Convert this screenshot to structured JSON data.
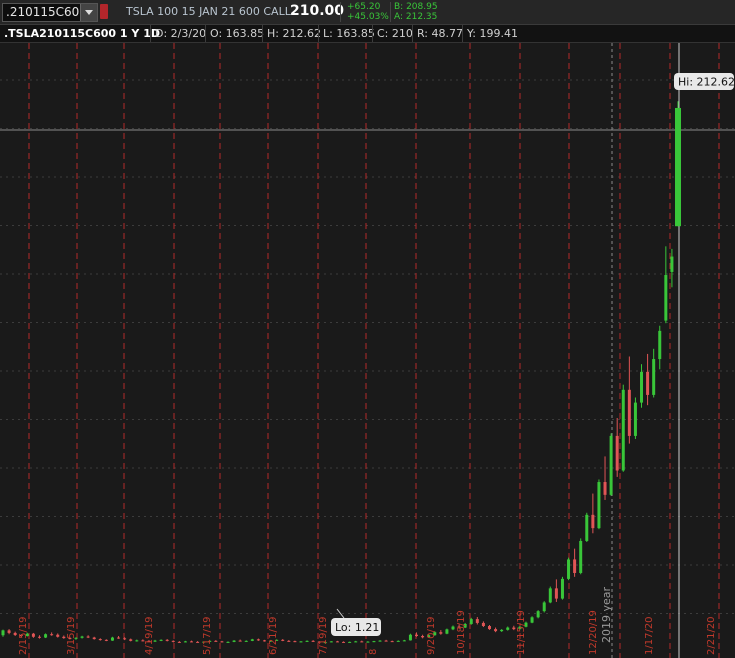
{
  "header": {
    "symbol": ".210115C600",
    "description": "TSLA 100 15 JAN 21 600 CALL",
    "last": "210.00",
    "net_change": "+65.20",
    "pct_change": "+45.03%",
    "bid": "B: 208.95",
    "ask": "A: 212.35"
  },
  "infobar": {
    "title": ".TSLA210115C600 1 Y 1D",
    "date": "D: 2/3/20",
    "open": "O: 163.85",
    "high": "H: 212.62",
    "low": "L: 163.85",
    "close": "C: 210",
    "range": "R: 48.77",
    "y": "Y: 199.41"
  },
  "chart_data": {
    "type": "candlestick",
    "x_tick_labels": [
      "2/15/19",
      "3/15/19",
      "4/19/19",
      "5/17/19",
      "6/21/19",
      "7/19/19",
      "8",
      "9/20/19",
      "10/18/19",
      "11/15/19",
      "12/20/19",
      "1/17/20",
      "2/21/20"
    ],
    "year_label": "2019 year",
    "high_label": "Hi: 212.62",
    "low_label": "Lo: 1.21",
    "ylim": [
      0,
      233
    ],
    "grid": true,
    "colors": {
      "up": "#39c639",
      "down": "#e05555",
      "grid": "#b32b2b",
      "background": "#1a1a1a"
    },
    "candles": [
      [
        4.2,
        6.4,
        3.6,
        6.1
      ],
      [
        6.1,
        6.6,
        4.6,
        5.1
      ],
      [
        5.1,
        5.6,
        3.9,
        4.3
      ],
      [
        4.3,
        4.6,
        3.4,
        3.9
      ],
      [
        3.9,
        5.2,
        3.7,
        4.8
      ],
      [
        4.8,
        5.1,
        3.2,
        3.6
      ],
      [
        3.6,
        4.2,
        2.9,
        3.3
      ],
      [
        3.3,
        4.9,
        3.1,
        4.6
      ],
      [
        4.6,
        5.3,
        4.0,
        4.4
      ],
      [
        4.4,
        4.9,
        3.3,
        3.6
      ],
      [
        3.6,
        4.1,
        2.8,
        3.1
      ],
      [
        3.1,
        3.6,
        2.6,
        2.9
      ],
      [
        2.9,
        3.4,
        2.4,
        3.2
      ],
      [
        3.2,
        4.0,
        2.9,
        3.7
      ],
      [
        3.7,
        4.2,
        3.1,
        3.3
      ],
      [
        3.3,
        3.6,
        2.5,
        2.7
      ],
      [
        2.7,
        3.0,
        2.1,
        2.4
      ],
      [
        2.4,
        2.6,
        1.9,
        2.1
      ],
      [
        2.1,
        3.6,
        2.0,
        3.3
      ],
      [
        3.3,
        3.9,
        2.8,
        3.0
      ],
      [
        3.0,
        3.4,
        2.3,
        2.6
      ],
      [
        2.6,
        2.9,
        1.8,
        2.0
      ],
      [
        2.0,
        2.5,
        1.7,
        2.2
      ],
      [
        2.2,
        2.6,
        1.8,
        2.0
      ],
      [
        2.0,
        2.3,
        1.5,
        1.7
      ],
      [
        1.7,
        2.4,
        1.6,
        2.1
      ],
      [
        2.1,
        2.6,
        1.9,
        2.4
      ],
      [
        2.4,
        2.7,
        1.8,
        2.0
      ],
      [
        2.0,
        2.2,
        1.4,
        1.6
      ],
      [
        1.6,
        1.9,
        1.3,
        1.5
      ],
      [
        1.5,
        2.0,
        1.4,
        1.8
      ],
      [
        1.8,
        2.1,
        1.5,
        1.6
      ],
      [
        1.6,
        1.9,
        1.3,
        1.4
      ],
      [
        1.4,
        1.8,
        1.3,
        1.7
      ],
      [
        1.7,
        2.2,
        1.6,
        2.0
      ],
      [
        2.0,
        2.3,
        1.7,
        1.8
      ],
      [
        1.8,
        2.0,
        1.4,
        1.5
      ],
      [
        1.5,
        1.8,
        1.3,
        1.6
      ],
      [
        1.6,
        2.3,
        1.5,
        2.1
      ],
      [
        2.1,
        2.5,
        1.8,
        1.9
      ],
      [
        1.9,
        2.2,
        1.6,
        2.0
      ],
      [
        2.0,
        2.8,
        1.9,
        2.6
      ],
      [
        2.6,
        2.9,
        2.0,
        2.2
      ],
      [
        2.2,
        2.4,
        1.7,
        1.9
      ],
      [
        1.9,
        2.2,
        1.6,
        2.1
      ],
      [
        2.1,
        2.6,
        2.0,
        2.4
      ],
      [
        2.4,
        2.7,
        1.9,
        2.0
      ],
      [
        2.0,
        2.3,
        1.7,
        1.9
      ],
      [
        1.9,
        2.1,
        1.5,
        1.6
      ],
      [
        1.6,
        1.9,
        1.4,
        1.8
      ],
      [
        1.8,
        2.2,
        1.6,
        2.0
      ],
      [
        2.0,
        2.3,
        1.6,
        1.7
      ],
      [
        1.7,
        1.9,
        1.3,
        1.4
      ],
      [
        1.4,
        1.7,
        1.21,
        1.5
      ],
      [
        1.5,
        1.9,
        1.4,
        1.8
      ],
      [
        1.8,
        2.0,
        1.5,
        1.6
      ],
      [
        1.6,
        1.8,
        1.3,
        1.4
      ],
      [
        1.4,
        1.7,
        1.3,
        1.6
      ],
      [
        1.6,
        2.0,
        1.5,
        1.8
      ],
      [
        1.8,
        2.1,
        1.5,
        1.6
      ],
      [
        1.6,
        1.9,
        1.4,
        1.7
      ],
      [
        1.7,
        2.0,
        1.5,
        1.9
      ],
      [
        1.9,
        2.3,
        1.7,
        2.1
      ],
      [
        2.1,
        2.4,
        1.8,
        1.9
      ],
      [
        1.9,
        2.1,
        1.6,
        1.8
      ],
      [
        1.8,
        2.2,
        1.7,
        2.0
      ],
      [
        2.0,
        2.4,
        1.9,
        2.2
      ],
      [
        2.2,
        4.8,
        2.1,
        4.4
      ],
      [
        4.4,
        5.3,
        3.6,
        3.9
      ],
      [
        3.9,
        4.4,
        3.0,
        3.4
      ],
      [
        3.4,
        4.6,
        3.2,
        4.2
      ],
      [
        4.2,
        5.8,
        4.0,
        5.4
      ],
      [
        5.4,
        6.2,
        4.4,
        4.8
      ],
      [
        4.8,
        6.8,
        4.6,
        6.5
      ],
      [
        6.5,
        8.0,
        6.2,
        7.6
      ],
      [
        7.6,
        8.4,
        6.8,
        7.2
      ],
      [
        7.2,
        9.0,
        7.0,
        8.6
      ],
      [
        8.6,
        11.0,
        8.3,
        10.5
      ],
      [
        10.5,
        11.3,
        8.4,
        9.0
      ],
      [
        9.0,
        9.6,
        7.4,
        7.8
      ],
      [
        7.8,
        8.2,
        6.3,
        6.6
      ],
      [
        6.6,
        7.2,
        5.4,
        5.8
      ],
      [
        5.8,
        6.6,
        5.5,
        6.3
      ],
      [
        6.3,
        7.6,
        6.0,
        7.2
      ],
      [
        7.2,
        7.9,
        6.2,
        6.6
      ],
      [
        6.6,
        7.8,
        6.4,
        7.5
      ],
      [
        7.5,
        9.5,
        7.3,
        9.1
      ],
      [
        9.1,
        11.6,
        8.9,
        11.2
      ],
      [
        11.2,
        14.0,
        10.8,
        13.6
      ],
      [
        13.6,
        17.5,
        13.1,
        17.0
      ],
      [
        17.0,
        23.2,
        16.7,
        22.5
      ],
      [
        22.5,
        26.0,
        17.2,
        18.5
      ],
      [
        18.5,
        27.0,
        18.1,
        26.2
      ],
      [
        26.2,
        34.5,
        25.7,
        33.8
      ],
      [
        33.8,
        38.0,
        27.0,
        28.5
      ],
      [
        28.5,
        42.0,
        28.0,
        41.0
      ],
      [
        41.0,
        52.0,
        40.6,
        51.2
      ],
      [
        51.2,
        59.5,
        44.0,
        46.0
      ],
      [
        46.0,
        65.0,
        45.6,
        64.0
      ],
      [
        64.0,
        74.0,
        57.0,
        59.0
      ],
      [
        59.0,
        83.0,
        58.6,
        82.0
      ],
      [
        82.0,
        89.0,
        66.0,
        68.5
      ],
      [
        68.5,
        102.0,
        68.0,
        100.0
      ],
      [
        100.0,
        113.0,
        79.0,
        82.0
      ],
      [
        82.0,
        97.0,
        80.8,
        95.0
      ],
      [
        95.0,
        110.0,
        93.0,
        107.0
      ],
      [
        107.0,
        114.0,
        94.0,
        98.0
      ],
      [
        98.0,
        116.0,
        97.0,
        112.0
      ],
      [
        112.0,
        125.0,
        108.0,
        123.0
      ],
      [
        127.0,
        156.0,
        126.0,
        144.8
      ],
      [
        146.0,
        155.0,
        140.0,
        152.0
      ],
      [
        163.85,
        212.62,
        163.85,
        210.0
      ]
    ]
  }
}
